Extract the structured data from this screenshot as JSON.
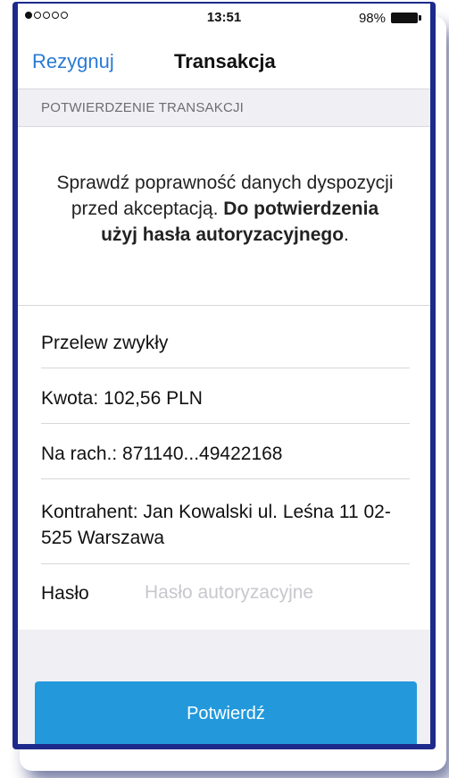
{
  "status_bar": {
    "time": "13:51",
    "battery": "98%"
  },
  "nav": {
    "cancel": "Rezygnuj",
    "title": "Transakcja"
  },
  "section_header": "POTWIERDZENIE TRANSAKCJI",
  "info": {
    "line_normal": "Sprawdź poprawność danych dyspozycji przed akceptacją.",
    "line_bold": "Do potwierdzenia użyj hasła autoryzacyjnego"
  },
  "details": {
    "transfer_type": "Przelew zwykły",
    "amount": "Kwota: 102,56 PLN",
    "account": "Na rach.: 871140...49422168",
    "contractor": "Kontrahent: Jan Kowalski ul. Leśna 11 02-525 Warszawa"
  },
  "password": {
    "label": "Hasło",
    "placeholder": "Hasło autoryzacyjne",
    "value": ""
  },
  "confirm_button": "Potwierdź"
}
